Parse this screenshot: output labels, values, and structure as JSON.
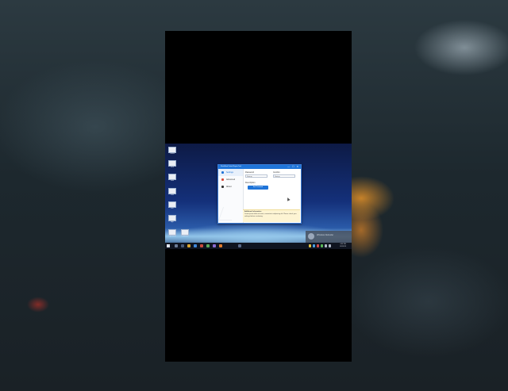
{
  "desktop_icons": [
    {
      "name": "desktop-icon-1",
      "label": "Vimeo"
    },
    {
      "name": "desktop-icon-2",
      "label": "Scrn"
    },
    {
      "name": "desktop-icon-3",
      "label": "Note"
    },
    {
      "name": "desktop-icon-4",
      "label": "Mail"
    },
    {
      "name": "desktop-icon-5",
      "label": "Doc"
    },
    {
      "name": "desktop-icon-6",
      "label": "App"
    },
    {
      "name": "desktop-icon-7",
      "label": "OpenShot"
    },
    {
      "name": "desktop-icon-8",
      "label": "Feedback"
    }
  ],
  "window": {
    "title": "FlashBoot Virtual Repair Tool",
    "controls": "— ☐ ✕",
    "nav": [
      {
        "label": "Settings",
        "active": true
      },
      {
        "label": "Advanced",
        "active": false
      },
      {
        "label": "About",
        "active": false
      }
    ],
    "fields": {
      "password_label": "Password",
      "password_value": "Startup",
      "confirm_label": "Confirm",
      "confirm_value": "Startup",
      "description_label": "Description",
      "action_button": "Set Password"
    },
    "notice": {
      "title": "Additional information",
      "text": "Lorem ipsum dolor sit amet, consectetur adipiscing elit. Please check your settings before continuing."
    }
  },
  "toast": {
    "text": "Windows Defender"
  },
  "taskbar": {
    "clock_time": "4:38 PM",
    "clock_date": "8/1/2023"
  },
  "colors": {
    "accent": "#1f74d8",
    "notice_bg": "#fdf4d3",
    "taskbar_bg": "#0f1420"
  }
}
